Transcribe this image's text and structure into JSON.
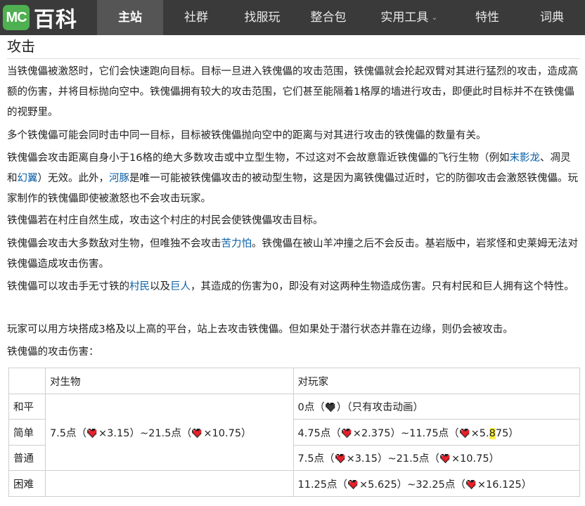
{
  "logo": {
    "badge": "MC",
    "text": "百科"
  },
  "nav": {
    "items": [
      "主站",
      "社群",
      "找服玩",
      "整合包",
      "实用工具",
      "特性",
      "词典"
    ]
  },
  "section_title": "攻击",
  "paragraphs": {
    "p1": "当铁傀儡被激怒时，它们会快速跑向目标。目标一旦进入铁傀儡的攻击范围，铁傀儡就会抡起双臂对其进行猛烈的攻击，造成高额的伤害，并将目标抛向空中。铁傀儡拥有较大的攻击范围，它们甚至能隔着1格厚的墙进行攻击，即便此时目标并不在铁傀儡的视野里。",
    "p2": "多个铁傀儡可能会同时击中同一目标，目标被铁傀儡抛向空中的距离与对其进行攻击的铁傀儡的数量有关。",
    "p3_a": "铁傀儡会攻击距离自身小于16格的绝大多数攻击或中立型生物，不过这对不会故意靠近铁傀儡的飞行生物（例如",
    "p3_link1": "末影龙",
    "p3_b": "、凋灵和",
    "p3_link2": "幻翼",
    "p3_c": "）无效。此外，",
    "p3_link3": "河豚",
    "p3_d": "是唯一可能被铁傀儡攻击的被动型生物，这是因为离铁傀儡过近时，它的防御攻击会激怒铁傀儡。玩家制作的铁傀儡即使被激怒也不会攻击玩家。",
    "p4": "铁傀儡若在村庄自然生成，攻击这个村庄的村民会使铁傀儡攻击目标。",
    "p5_a": "铁傀儡会攻击大多数敌对生物，但唯独不会攻击",
    "p5_link": "苦力怕",
    "p5_b": "。铁傀儡在被山羊冲撞之后不会反击。基岩版中，岩浆怪和史莱姆无法对铁傀儡造成攻击伤害。",
    "p6_a": "铁傀儡可以攻击手无寸铁的",
    "p6_link1": "村民",
    "p6_b": "以及",
    "p6_link2": "巨人",
    "p6_c": "，其造成的伤害为0，即没有对这两种生物造成伤害。只有村民和巨人拥有这个特性。",
    "p7": "玩家可以用方块搭成3格及以上高的平台，站上去攻击铁傀儡。但如果处于潜行状态并靠在边缘，则仍会被攻击。",
    "p8": "铁傀儡的攻击伤害："
  },
  "table": {
    "headers": {
      "mob": "对生物",
      "player": "对玩家"
    },
    "mob_damage": {
      "a": "7.5点（",
      "b": "×3.15）~21.5点（",
      "c": "×10.75）"
    },
    "rows": {
      "peaceful": {
        "label": "和平",
        "a": "0点（",
        "b": "）（只有攻击动画）"
      },
      "easy": {
        "label": "简单",
        "a": "4.75点（",
        "b": "×2.375）~11.75点（",
        "c": "×5.",
        "c_hl": "8",
        "c_end": "75）"
      },
      "normal": {
        "label": "普通",
        "a": "7.5点（",
        "b": "×3.15）~21.5点（",
        "c": "×10.75）"
      },
      "hard": {
        "label": "困难",
        "a": "11.25点（",
        "b": "×5.625）~32.25点（",
        "c": "×16.125）"
      }
    }
  },
  "colors": {
    "nav_bg": "#3a3a3a",
    "nav_active": "#555555",
    "logo_green": "#4eb050",
    "link": "#0b5fa5",
    "heart": "#e8202a"
  }
}
